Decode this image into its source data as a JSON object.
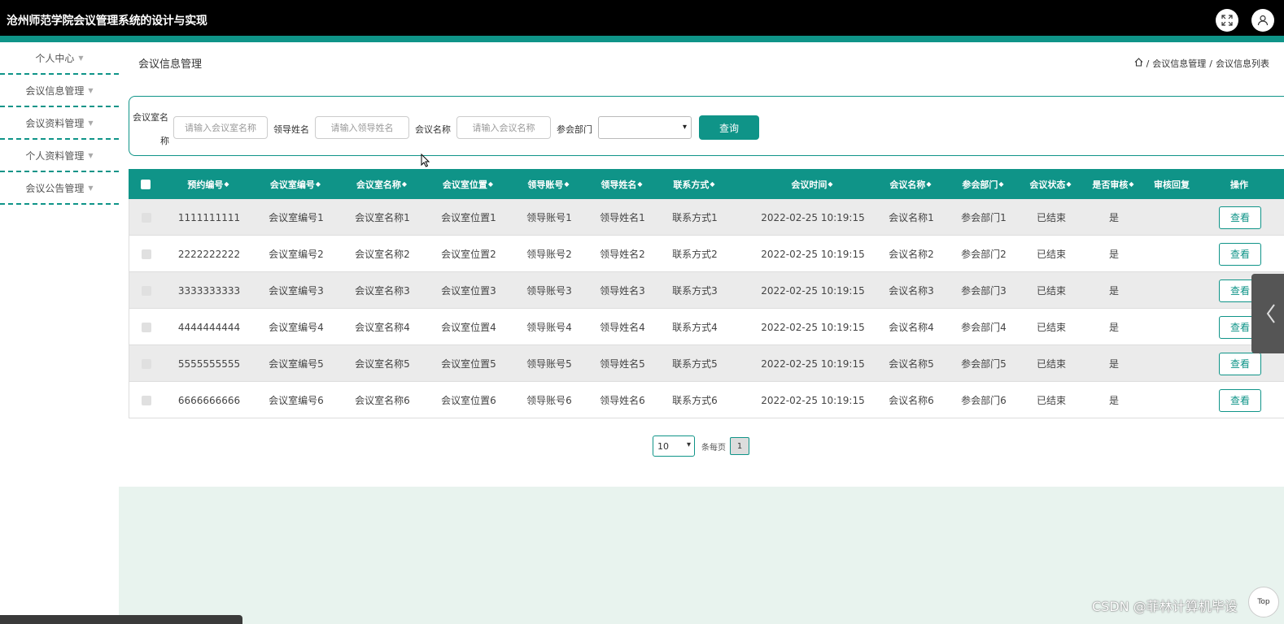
{
  "header": {
    "title": "沧州师范学院会议管理系统的设计与实现",
    "icons": [
      "fullscreen-icon",
      "user-icon"
    ]
  },
  "sidebar": {
    "items": [
      {
        "label": "个人中心"
      },
      {
        "label": "会议信息管理"
      },
      {
        "label": "会议资料管理"
      },
      {
        "label": "个人资料管理"
      },
      {
        "label": "会议公告管理"
      }
    ]
  },
  "page": {
    "title": "会议信息管理",
    "breadcrumb": [
      "会议信息管理",
      "会议信息列表"
    ]
  },
  "search": {
    "room_name_label_1": "会议室名",
    "room_name_label_2": "称",
    "room_name_placeholder": "请输入会议室名称",
    "leader_label": "领导姓名",
    "leader_placeholder": "请输入领导姓名",
    "meeting_label": "会议名称",
    "meeting_placeholder": "请输入会议名称",
    "dept_label": "参会部门",
    "dept_value": "",
    "query_label": "查询"
  },
  "table": {
    "headers": [
      "预约编号",
      "会议室编号",
      "会议室名称",
      "会议室位置",
      "领导账号",
      "领导姓名",
      "联系方式",
      "会议时间",
      "会议名称",
      "参会部门",
      "会议状态",
      "是否审核",
      "审核回复",
      "操作"
    ],
    "view_label": "查看",
    "rows": [
      {
        "id": "1111111111",
        "room_no": "会议室编号1",
        "room_name": "会议室名称1",
        "room_loc": "会议室位置1",
        "leader_acc": "领导账号1",
        "leader_name": "领导姓名1",
        "contact": "联系方式1",
        "time": "2022-02-25 10:19:15",
        "meeting": "会议名称1",
        "dept": "参会部门1",
        "status": "已结束",
        "reviewed": "是",
        "reply": ""
      },
      {
        "id": "2222222222",
        "room_no": "会议室编号2",
        "room_name": "会议室名称2",
        "room_loc": "会议室位置2",
        "leader_acc": "领导账号2",
        "leader_name": "领导姓名2",
        "contact": "联系方式2",
        "time": "2022-02-25 10:19:15",
        "meeting": "会议名称2",
        "dept": "参会部门2",
        "status": "已结束",
        "reviewed": "是",
        "reply": ""
      },
      {
        "id": "3333333333",
        "room_no": "会议室编号3",
        "room_name": "会议室名称3",
        "room_loc": "会议室位置3",
        "leader_acc": "领导账号3",
        "leader_name": "领导姓名3",
        "contact": "联系方式3",
        "time": "2022-02-25 10:19:15",
        "meeting": "会议名称3",
        "dept": "参会部门3",
        "status": "已结束",
        "reviewed": "是",
        "reply": ""
      },
      {
        "id": "4444444444",
        "room_no": "会议室编号4",
        "room_name": "会议室名称4",
        "room_loc": "会议室位置4",
        "leader_acc": "领导账号4",
        "leader_name": "领导姓名4",
        "contact": "联系方式4",
        "time": "2022-02-25 10:19:15",
        "meeting": "会议名称4",
        "dept": "参会部门4",
        "status": "已结束",
        "reviewed": "是",
        "reply": ""
      },
      {
        "id": "5555555555",
        "room_no": "会议室编号5",
        "room_name": "会议室名称5",
        "room_loc": "会议室位置5",
        "leader_acc": "领导账号5",
        "leader_name": "领导姓名5",
        "contact": "联系方式5",
        "time": "2022-02-25 10:19:15",
        "meeting": "会议名称5",
        "dept": "参会部门5",
        "status": "已结束",
        "reviewed": "是",
        "reply": ""
      },
      {
        "id": "6666666666",
        "room_no": "会议室编号6",
        "room_name": "会议室名称6",
        "room_loc": "会议室位置6",
        "leader_acc": "领导账号6",
        "leader_name": "领导姓名6",
        "contact": "联系方式6",
        "time": "2022-02-25 10:19:15",
        "meeting": "会议名称6",
        "dept": "参会部门6",
        "status": "已结束",
        "reviewed": "是",
        "reply": ""
      }
    ]
  },
  "pagination": {
    "page_size": "10",
    "per_page_label": "条每页",
    "current_page": "1"
  },
  "misc": {
    "back_to_top": "Top",
    "watermark": "CSDN @菲林计算机毕设"
  },
  "colors": {
    "accent": "#0f9488",
    "header_bg": "#000000",
    "footer_bg": "#e8f3ee"
  }
}
